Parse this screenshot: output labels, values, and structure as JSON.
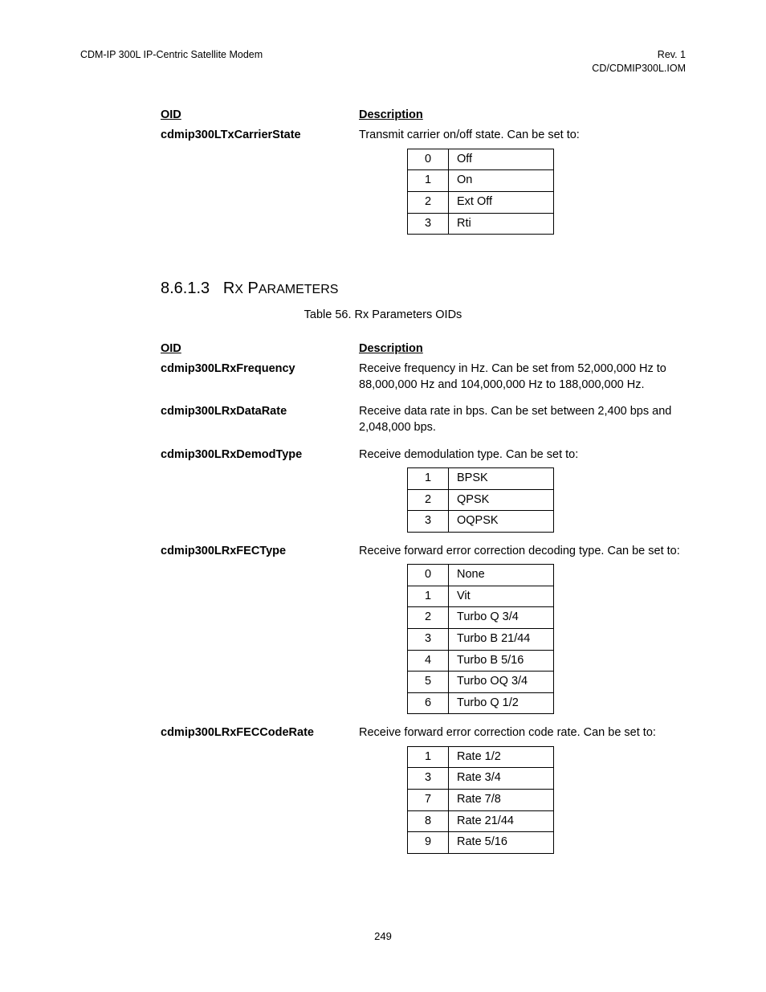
{
  "header": {
    "left": "CDM-IP 300L IP-Centric Satellite Modem",
    "right_top": "Rev. 1",
    "right_bottom": "CD/CDMIP300L.IOM"
  },
  "section_first": {
    "col_oid": "OID",
    "col_desc": "Description",
    "rows": [
      {
        "oid": "cdmip300LTxCarrierState",
        "desc": "Transmit carrier on/off state. Can be set to:",
        "values": [
          {
            "k": "0",
            "v": "Off"
          },
          {
            "k": "1",
            "v": "On"
          },
          {
            "k": "2",
            "v": "Ext Off"
          },
          {
            "k": "3",
            "v": "Rti"
          }
        ]
      }
    ]
  },
  "heading": {
    "num": "8.6.1.3",
    "title_first": "R",
    "title_small": "X",
    "title_word_first": "P",
    "title_word_rest": "ARAMETERS"
  },
  "table_caption": "Table 56. Rx Parameters OIDs",
  "section_rx": {
    "col_oid": "OID",
    "col_desc": "Description",
    "rows": [
      {
        "oid": "cdmip300LRxFrequency",
        "desc": "Receive frequency in Hz. Can be set from 52,000,000 Hz to 88,000,000 Hz and 104,000,000 Hz to 188,000,000 Hz."
      },
      {
        "oid": "cdmip300LRxDataRate",
        "desc": "Receive data rate in bps. Can be set between 2,400 bps and 2,048,000 bps."
      },
      {
        "oid": "cdmip300LRxDemodType",
        "desc": "Receive demodulation type. Can be set to:",
        "values": [
          {
            "k": "1",
            "v": "BPSK"
          },
          {
            "k": "2",
            "v": "QPSK"
          },
          {
            "k": "3",
            "v": "OQPSK"
          }
        ]
      },
      {
        "oid": "cdmip300LRxFECType",
        "desc": "Receive forward error correction decoding type. Can be set to:",
        "values": [
          {
            "k": "0",
            "v": "None"
          },
          {
            "k": "1",
            "v": "Vit"
          },
          {
            "k": "2",
            "v": "Turbo Q 3/4"
          },
          {
            "k": "3",
            "v": "Turbo B 21/44"
          },
          {
            "k": "4",
            "v": "Turbo B 5/16"
          },
          {
            "k": "5",
            "v": "Turbo OQ 3/4"
          },
          {
            "k": "6",
            "v": "Turbo Q 1/2"
          }
        ]
      },
      {
        "oid": "cdmip300LRxFECCodeRate",
        "desc": "Receive forward error correction code rate. Can be set to:",
        "values": [
          {
            "k": "1",
            "v": "Rate 1/2"
          },
          {
            "k": "3",
            "v": "Rate 3/4"
          },
          {
            "k": "7",
            "v": "Rate 7/8"
          },
          {
            "k": "8",
            "v": "Rate 21/44"
          },
          {
            "k": "9",
            "v": "Rate 5/16"
          }
        ]
      }
    ]
  },
  "page_number": "249"
}
